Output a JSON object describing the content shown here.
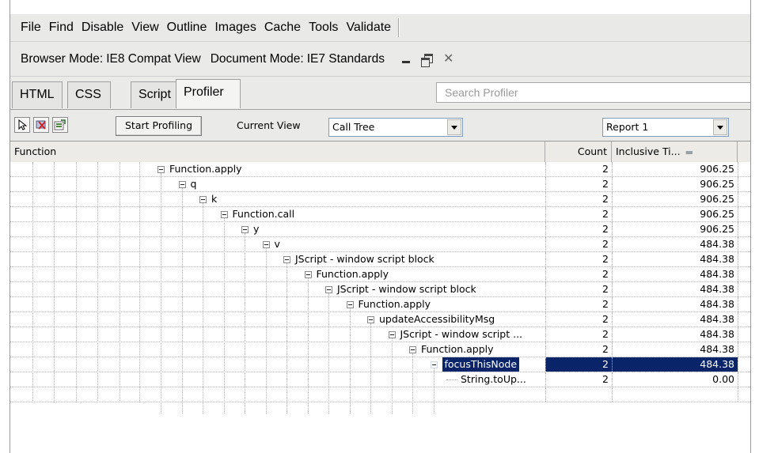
{
  "menubar": {
    "items": [
      "File",
      "Find",
      "Disable",
      "View",
      "Outline",
      "Images",
      "Cache",
      "Tools",
      "Validate"
    ]
  },
  "modebar": {
    "browser_mode_label": "Browser Mode:",
    "browser_mode_value": "IE8 Compat View",
    "document_mode_label": "Document Mode:",
    "document_mode_value": "IE7 Standards"
  },
  "tabs": [
    {
      "label": "HTML",
      "active": false
    },
    {
      "label": "CSS",
      "active": false
    },
    {
      "label": "Script",
      "active": false
    },
    {
      "label": "Profiler",
      "active": true
    }
  ],
  "search": {
    "placeholder": "Search Profiler"
  },
  "toolbar": {
    "icons": [
      "select-arrow-icon",
      "clear-icon",
      "export-icon"
    ],
    "start_button": "Start Profiling",
    "current_view_label": "Current View",
    "current_view_value": "Call Tree",
    "report_value": "Report 1"
  },
  "grid": {
    "columns": {
      "function": "Function",
      "count": "Count",
      "inclusive": "Inclusive Ti..."
    },
    "rows": [
      {
        "name": "Function.apply",
        "count": "2",
        "inclusive": "906.25",
        "depth": 0,
        "type": "node"
      },
      {
        "name": "q",
        "count": "2",
        "inclusive": "906.25",
        "depth": 1,
        "type": "node"
      },
      {
        "name": "k",
        "count": "2",
        "inclusive": "906.25",
        "depth": 2,
        "type": "node"
      },
      {
        "name": "Function.call",
        "count": "2",
        "inclusive": "906.25",
        "depth": 3,
        "type": "node"
      },
      {
        "name": "y",
        "count": "2",
        "inclusive": "906.25",
        "depth": 4,
        "type": "node"
      },
      {
        "name": "v",
        "count": "2",
        "inclusive": "484.38",
        "depth": 5,
        "type": "node"
      },
      {
        "name": "JScript - window script block",
        "count": "2",
        "inclusive": "484.38",
        "depth": 6,
        "type": "node"
      },
      {
        "name": "Function.apply",
        "count": "2",
        "inclusive": "484.38",
        "depth": 7,
        "type": "node"
      },
      {
        "name": "JScript - window script block",
        "count": "2",
        "inclusive": "484.38",
        "depth": 8,
        "type": "node"
      },
      {
        "name": "Function.apply",
        "count": "2",
        "inclusive": "484.38",
        "depth": 9,
        "type": "node"
      },
      {
        "name": "updateAccessibilityMsg",
        "count": "2",
        "inclusive": "484.38",
        "depth": 10,
        "type": "node"
      },
      {
        "name": "JScript - window script ...",
        "count": "2",
        "inclusive": "484.38",
        "depth": 11,
        "type": "node"
      },
      {
        "name": "Function.apply",
        "count": "2",
        "inclusive": "484.38",
        "depth": 12,
        "type": "node"
      },
      {
        "name": "focusThisNode",
        "count": "2",
        "inclusive": "484.38",
        "depth": 13,
        "type": "node",
        "selected": true
      },
      {
        "name": "String.toUp...",
        "count": "2",
        "inclusive": "0.00",
        "depth": 14,
        "type": "leaf"
      }
    ]
  }
}
